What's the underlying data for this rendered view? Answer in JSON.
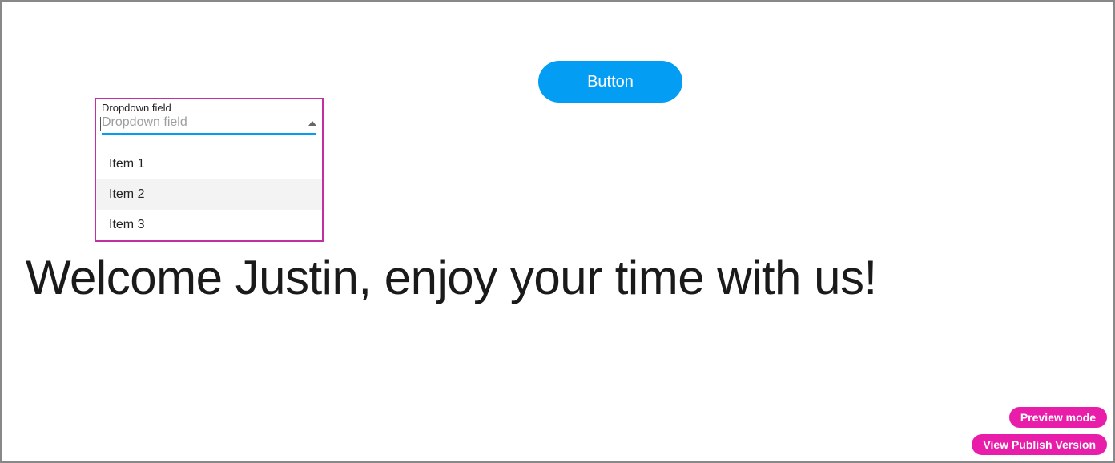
{
  "main": {
    "button_label": "Button",
    "welcome_message": "Welcome Justin, enjoy your time with us!"
  },
  "dropdown": {
    "label": "Dropdown field",
    "placeholder": "Dropdown field",
    "items": [
      {
        "label": "Item 1"
      },
      {
        "label": "Item 2"
      },
      {
        "label": "Item 3"
      }
    ],
    "hovered_index": 1
  },
  "footer": {
    "preview_label": "Preview mode",
    "publish_label": "View Publish Version"
  }
}
